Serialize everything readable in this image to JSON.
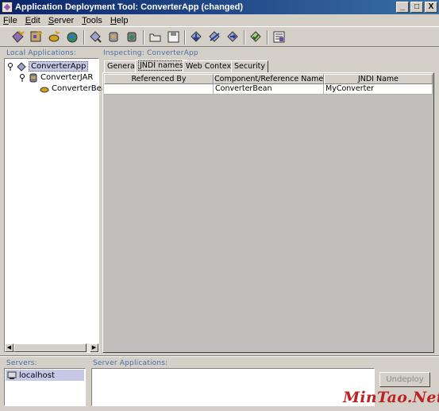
{
  "window": {
    "title": "Application Deployment Tool: ConverterApp (changed)",
    "minimize": "_",
    "maximize": "□",
    "close": "X"
  },
  "menu": [
    "File",
    "Edit",
    "Server",
    "Tools",
    "Help"
  ],
  "toolbar_icons": [
    "new-application-icon",
    "new-ejb-icon",
    "new-web-component-icon",
    "new-client-icon",
    "add-to-app-icon",
    "add-ejb-jar-icon",
    "add-web-war-icon",
    "open-icon",
    "save-icon",
    "deploy-icon",
    "undeploy-icon",
    "update-icon",
    "verify-icon",
    "descriptor-viewer-icon"
  ],
  "left_panel": {
    "label": "Local Applications:",
    "tree": [
      {
        "label": "ConverterApp",
        "level": 0,
        "selected": true,
        "icon": "application-icon"
      },
      {
        "label": "ConverterJAR",
        "level": 1,
        "selected": false,
        "icon": "jar-icon"
      },
      {
        "label": "ConverterBean",
        "level": 2,
        "selected": false,
        "icon": "bean-icon"
      }
    ]
  },
  "inspector": {
    "label": "Inspecting: ConverterApp",
    "tabs": [
      "General",
      "JNDI names",
      "Web Context",
      "Security"
    ],
    "active_tab": "JNDI names",
    "table": {
      "headers": [
        "Referenced By",
        "Component/Reference Name",
        "JNDI Name"
      ],
      "rows": [
        [
          "",
          "ConverterBean",
          "MyConverter"
        ]
      ]
    }
  },
  "servers": {
    "label": "Servers:",
    "items": [
      "localhost"
    ]
  },
  "server_apps": {
    "label": "Server Applications:",
    "undeploy_label": "Undeploy"
  },
  "watermark": "MinTao.Net"
}
